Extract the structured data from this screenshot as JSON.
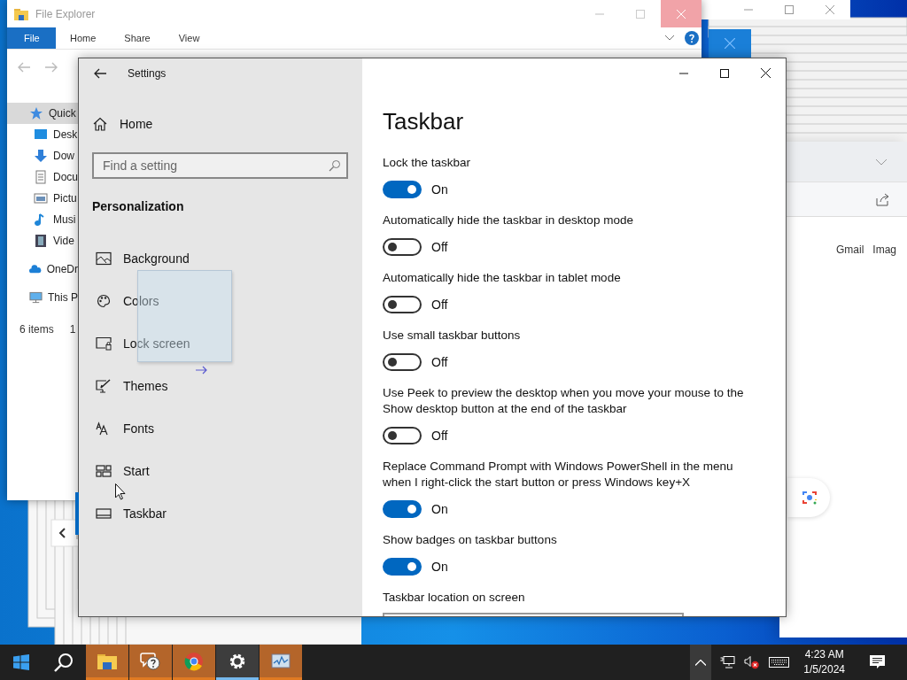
{
  "file_explorer": {
    "title": "File Explorer",
    "ribbon_tabs": [
      {
        "label": "File",
        "selected": true
      },
      {
        "label": "Home",
        "selected": false
      },
      {
        "label": "Share",
        "selected": false
      },
      {
        "label": "View",
        "selected": false
      }
    ],
    "nav_items": [
      {
        "label": "Quick",
        "selected": true
      },
      {
        "label": "Desk",
        "selected": false
      },
      {
        "label": "Dow",
        "selected": false
      },
      {
        "label": "Docu",
        "selected": false
      },
      {
        "label": "Pictu",
        "selected": false
      },
      {
        "label": "Musi",
        "selected": false
      },
      {
        "label": "Vide",
        "selected": false
      },
      {
        "label": "OneDr",
        "selected": false
      },
      {
        "label": "This P",
        "selected": false
      }
    ],
    "status_bar": [
      "6 items",
      "1"
    ]
  },
  "browser": {
    "links": [
      "Gmail",
      "Imag"
    ]
  },
  "settings": {
    "title": "Settings",
    "home": "Home",
    "search": {
      "placeholder": "Find a setting"
    },
    "section": "Personalization",
    "nav": [
      {
        "label": "Background",
        "selected": false
      },
      {
        "label": "Colors",
        "selected": false
      },
      {
        "label": "Lock screen",
        "selected": false
      },
      {
        "label": "Themes",
        "selected": false
      },
      {
        "label": "Fonts",
        "selected": false
      },
      {
        "label": "Start",
        "selected": false
      },
      {
        "label": "Taskbar",
        "selected": true
      }
    ],
    "page_title": "Taskbar",
    "options": [
      {
        "label": "Lock the taskbar",
        "on": true,
        "state": "On"
      },
      {
        "label": "Automatically hide the taskbar in desktop mode",
        "on": false,
        "state": "Off"
      },
      {
        "label": "Automatically hide the taskbar in tablet mode",
        "on": false,
        "state": "Off"
      },
      {
        "label": "Use small taskbar buttons",
        "on": false,
        "state": "Off"
      },
      {
        "label": "Use Peek to preview the desktop when you move your mouse to the Show desktop button at the end of the taskbar",
        "on": false,
        "state": "Off"
      },
      {
        "label": "Replace Command Prompt with Windows PowerShell in the menu when I right-click the start button or press Windows key+X",
        "on": true,
        "state": "On"
      },
      {
        "label": "Show badges on taskbar buttons",
        "on": true,
        "state": "On"
      }
    ],
    "location_label": "Taskbar location on screen"
  },
  "taskbar": {
    "apps": [
      {
        "selected": false
      },
      {
        "selected": false
      },
      {
        "selected": false
      },
      {
        "selected": true
      },
      {
        "selected": false
      }
    ],
    "time": "4:23 AM",
    "date": "1/5/2024"
  }
}
